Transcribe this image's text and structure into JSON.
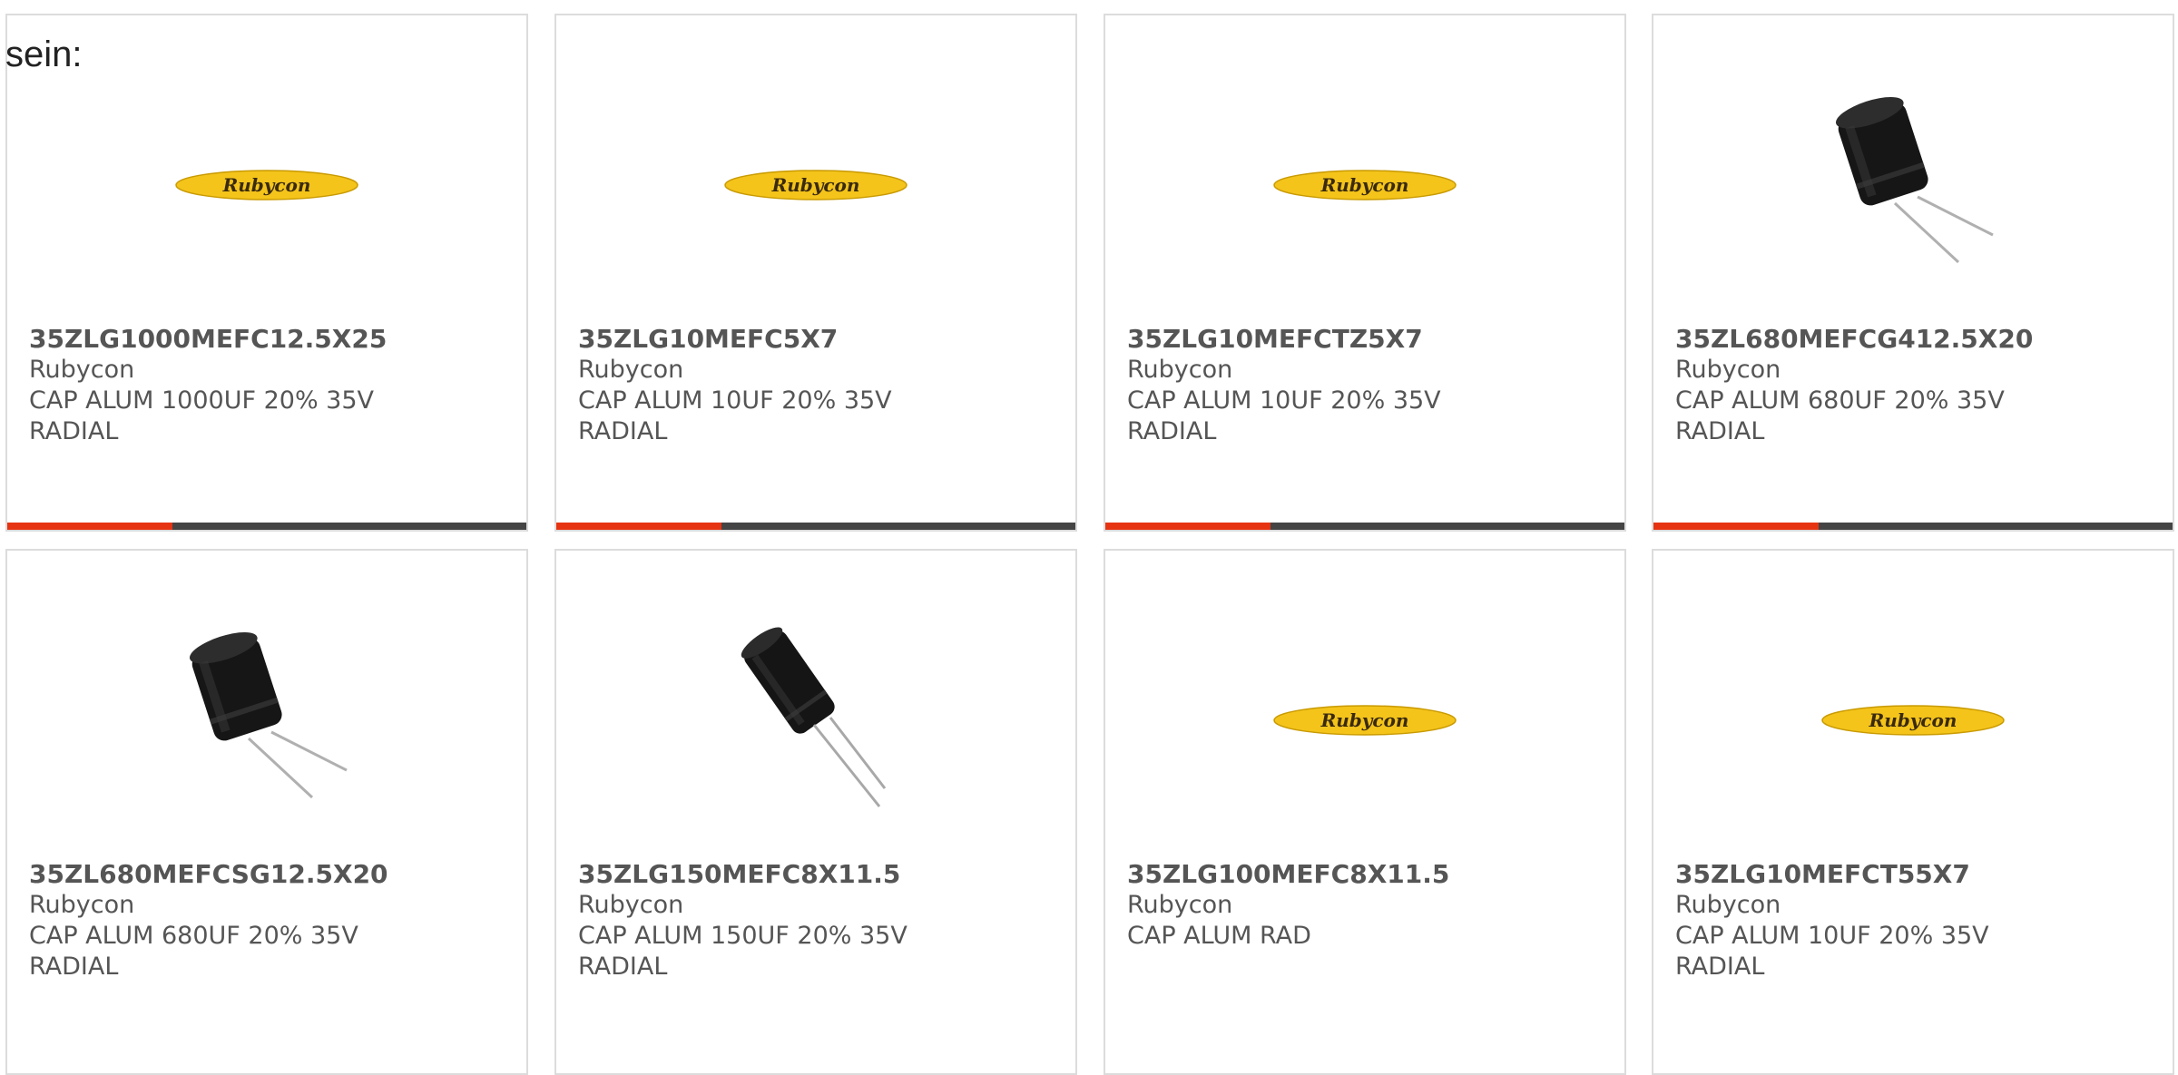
{
  "intro": "sein:",
  "colors": {
    "accent": "#e63312",
    "bar": "#444444",
    "brand_yellow": "#f4c41b"
  },
  "products": [
    {
      "part": "35ZLG1000MEFC12.5X25",
      "brand": "Rubycon",
      "desc1": "CAP ALUM 1000UF 20% 35V",
      "desc2": "RADIAL",
      "image": "logo",
      "logo_text": "Rubycon"
    },
    {
      "part": "35ZLG10MEFC5X7",
      "brand": "Rubycon",
      "desc1": "CAP ALUM 10UF 20% 35V",
      "desc2": "RADIAL",
      "image": "logo",
      "logo_text": "Rubycon"
    },
    {
      "part": "35ZLG10MEFCTZ5X7",
      "brand": "Rubycon",
      "desc1": "CAP ALUM 10UF 20% 35V",
      "desc2": "RADIAL",
      "image": "logo",
      "logo_text": "Rubycon"
    },
    {
      "part": "35ZL680MEFCG412.5X20",
      "brand": "Rubycon",
      "desc1": "CAP ALUM 680UF 20% 35V",
      "desc2": "RADIAL",
      "image": "capacitor-upright"
    },
    {
      "part": "35ZL680MEFCSG12.5X20",
      "brand": "Rubycon",
      "desc1": "CAP ALUM 680UF 20% 35V",
      "desc2": "RADIAL",
      "image": "capacitor-upright"
    },
    {
      "part": "35ZLG150MEFC8X11.5",
      "brand": "Rubycon",
      "desc1": "CAP ALUM 150UF 20% 35V",
      "desc2": "RADIAL",
      "image": "capacitor-tilted"
    },
    {
      "part": "35ZLG100MEFC8X11.5",
      "brand": "Rubycon",
      "desc1": "CAP ALUM RAD",
      "desc2": "",
      "image": "logo",
      "logo_text": "Rubycon"
    },
    {
      "part": "35ZLG10MEFCT55X7",
      "brand": "Rubycon",
      "desc1": "CAP ALUM 10UF 20% 35V",
      "desc2": "RADIAL",
      "image": "logo",
      "logo_text": "Rubycon"
    }
  ]
}
